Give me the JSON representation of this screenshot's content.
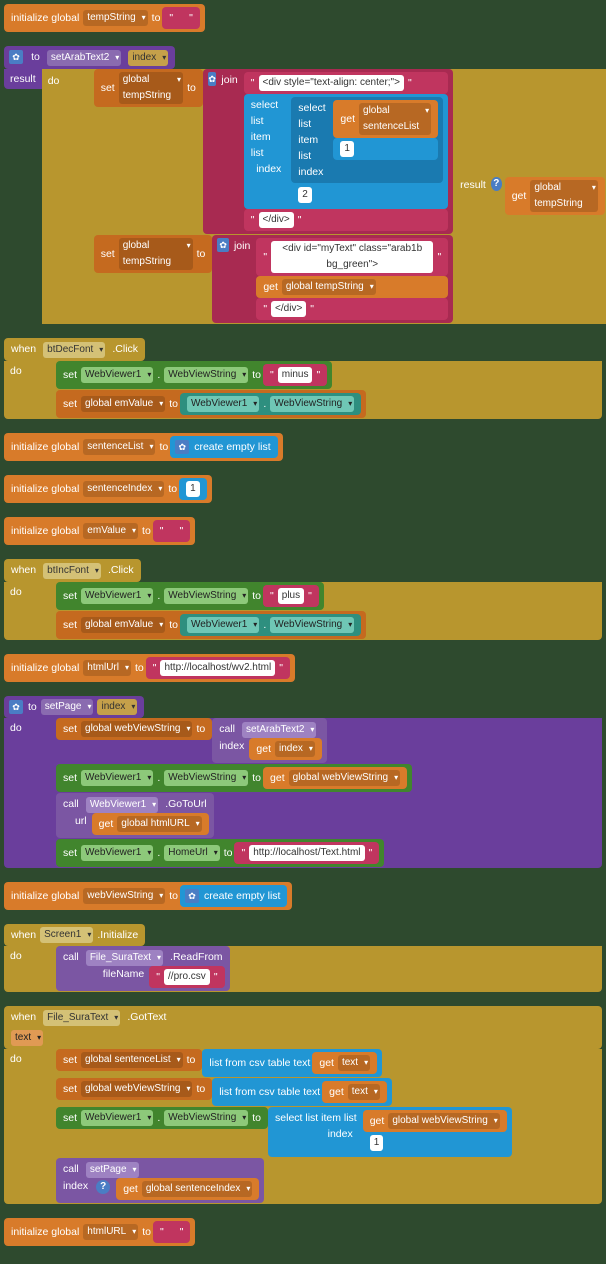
{
  "b1": {
    "initialize_global": "initialize global",
    "var": "tempString",
    "to": "to",
    "val": " "
  },
  "b2": {
    "to": "to",
    "proc": "setArabText2",
    "param": "index",
    "result": "result",
    "do": "do",
    "set1": "set",
    "var1": "global tempString",
    "to1": "to",
    "join": "join",
    "str1": " <div style=\"text-align: center;\"> ",
    "select_list_item": "select list item  list",
    "select_list_item2": "select list item  list",
    "get": "get",
    "global_sentenceList": "global sentenceList",
    "index_lbl": "index",
    "one": "1",
    "two": "2",
    "str2": " </div> ",
    "str3": " <div id=\"myText\" class=\"arab1b bg_green\"> ",
    "global_tempString": "global tempString",
    "str4": " </div> ",
    "result_lbl": "result"
  },
  "b3": {
    "when": "when",
    "comp": "btDecFont",
    "evt": ".Click",
    "do": "do",
    "set": "set",
    "wv1": "WebViewer1",
    "wvs": "WebViewString",
    "to": "to",
    "minus": " minus ",
    "set2": "set",
    "emVal": "global emValue",
    "to2": "to"
  },
  "b4": {
    "initialize_global": "initialize global",
    "var": "sentenceList",
    "to": "to",
    "create_empty_list": "create empty list"
  },
  "b5": {
    "initialize_global": "initialize global",
    "var": "sentenceIndex",
    "to": "to",
    "val": "1"
  },
  "b6": {
    "initialize_global": "initialize global",
    "var": "emValue",
    "to": "to",
    "val": " "
  },
  "b7": {
    "when": "when",
    "comp": "btIncFont",
    "evt": ".Click",
    "do": "do",
    "set": "set",
    "wv1": "WebViewer1",
    "wvs": "WebViewString",
    "to": "to",
    "plus": " plus ",
    "set2": "set",
    "emVal": "global emValue",
    "to2": "to"
  },
  "b8": {
    "initialize_global": "initialize global",
    "var": "htmlUrl",
    "to": "to",
    "val": " http://localhost/wv2.html "
  },
  "b9": {
    "to": "to",
    "proc": "setPage",
    "param": "index",
    "do": "do",
    "set": "set",
    "gwvs": "global webViewString",
    "to1": "to",
    "call": "call",
    "setArabText2": "setArabText2",
    "index_lbl": "index",
    "get": "get",
    "index_var": "index",
    "set2": "set",
    "wv1": "WebViewer1",
    "wvs": "WebViewString",
    "to2": "to",
    "get2": "get",
    "gwvs2": "global webViewString",
    "call2": "call",
    "gotourl": ".GoToUrl",
    "url": "url",
    "get3": "get",
    "ghtmlurl": "global htmlURL",
    "set3": "set",
    "homeurl": "HomeUrl",
    "to3": "to",
    "texturl": " http://localhost/Text.html "
  },
  "b10": {
    "initialize_global": "initialize global",
    "var": "webViewString",
    "to": "to",
    "create_empty_list": "create empty list"
  },
  "b11": {
    "when": "when",
    "comp": "Screen1",
    "evt": ".Initialize",
    "do": "do",
    "call": "call",
    "file": "File_SuraText",
    "readfrom": ".ReadFrom",
    "filename": "fileName",
    "csv": " //pro.csv "
  },
  "b12": {
    "when": "when",
    "comp": "File_SuraText",
    "evt": ".GotText",
    "text_param": "text",
    "do": "do",
    "set": "set",
    "gsl": "global sentenceList",
    "to": "to",
    "listfromcsv": "list from csv table  text",
    "get": "get",
    "text_var": "text",
    "set2": "set",
    "gwvs": "global webViewString",
    "to2": "to",
    "set3": "set",
    "wv1": "WebViewer1",
    "wvs": "WebViewString",
    "to3": "to",
    "select_list_item": "select list item  list",
    "get2": "get",
    "gwvs2": "global webViewString",
    "index_lbl": "index",
    "one": "1",
    "call": "call",
    "setPage": "setPage",
    "index_lbl2": "index",
    "get3": "get",
    "gsi": "global sentenceIndex"
  },
  "b13": {
    "initialize_global": "initialize global",
    "var": "htmlURL",
    "to": "to",
    "val": " "
  }
}
